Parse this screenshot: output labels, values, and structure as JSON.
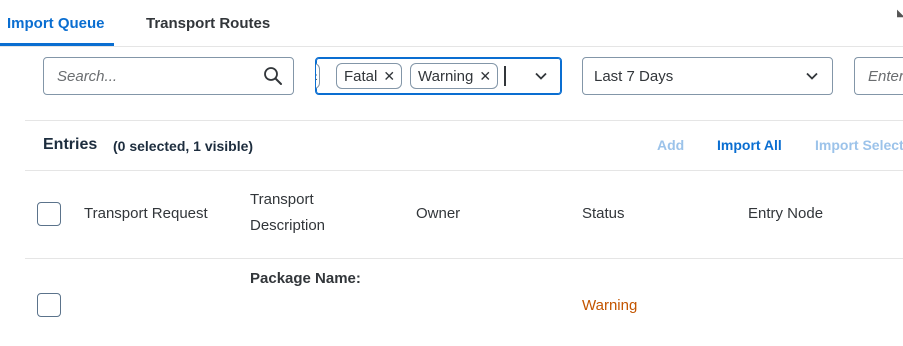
{
  "tabs": [
    {
      "label": "Import Queue",
      "active": true
    },
    {
      "label": "Transport Routes",
      "active": false
    }
  ],
  "filters": {
    "search_placeholder": "Search...",
    "status_tokens": [
      "Fatal",
      "Warning"
    ],
    "date_range": "Last 7 Days",
    "next_placeholder": "Enter..."
  },
  "entries": {
    "title": "Entries",
    "count": "(0 selected, 1 visible)",
    "actions": {
      "add": "Add",
      "import_all": "Import All",
      "import_selected": "Import Selected"
    }
  },
  "table": {
    "columns": {
      "request": "Transport Request",
      "description_line1": "Transport",
      "description_line2": "Description",
      "owner": "Owner",
      "status": "Status",
      "entry_node": "Entry Node"
    },
    "rows": [
      {
        "description": "Package Name:",
        "status": "Warning"
      }
    ]
  },
  "colors": {
    "accent": "#0a6ed1",
    "warning": "#c35500",
    "disabled_action": "#9cc3ea"
  }
}
